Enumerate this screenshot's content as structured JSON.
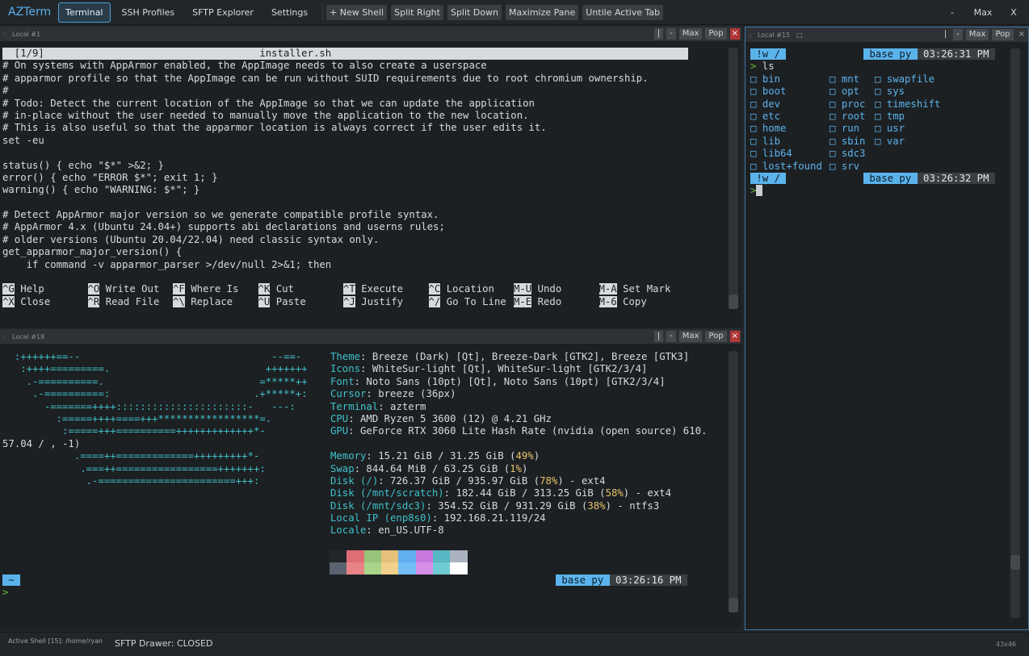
{
  "app": {
    "title": "AZTerm"
  },
  "tabs": [
    "Terminal",
    "SSH Profiles",
    "SFTP Explorer",
    "Settings"
  ],
  "toolbar": {
    "new_shell": "+ New Shell",
    "split_right": "Split Right",
    "split_down": "Split Down",
    "maximize_pane": "Maximize Pane",
    "untile": "Untile Active Tab"
  },
  "window_controls": {
    "minimize": "-",
    "maximize": "Max",
    "close": "X"
  },
  "pane_buttons": {
    "divider": "|",
    "minus": "-",
    "max": "Max",
    "pop": "Pop",
    "close": "×"
  },
  "panes": {
    "top_left": {
      "title": "Local #1",
      "nano": {
        "title_bar": "  [1/9]                                    installer.sh                                    ",
        "lines": [
          "# On systems with AppArmor enabled, the AppImage needs to also create a userspace",
          "# apparmor profile so that the AppImage can be run without SUID requirements due to root chromium ownership.",
          "#",
          "# Todo: Detect the current location of the AppImage so that we can update the application",
          "# in-place without the user needed to manually move the application to the new location.",
          "# This is also useful so that the apparmor location is always correct if the user edits it.",
          "set -eu",
          "",
          "status() { echo \"$*\" >&2; }",
          "error() { echo \"ERROR $*\"; exit 1; }",
          "warning() { echo \"WARNING: $*\"; }",
          "",
          "# Detect AppArmor major version so we generate compatible profile syntax.",
          "# AppArmor 4.x (Ubuntu 24.04+) supports abi declarations and userns rules;",
          "# older versions (Ubuntu 20.04/22.04) need classic syntax only.",
          "get_apparmor_major_version() {",
          "    if command -v apparmor_parser >/dev/null 2>&1; then"
        ],
        "shortcuts_row1": [
          {
            "key": "^G",
            "label": "Help"
          },
          {
            "key": "^O",
            "label": "Write Out"
          },
          {
            "key": "^F",
            "label": "Where Is"
          },
          {
            "key": "^K",
            "label": "Cut"
          },
          {
            "key": "^T",
            "label": "Execute"
          },
          {
            "key": "^C",
            "label": "Location"
          },
          {
            "key": "M-U",
            "label": "Undo"
          },
          {
            "key": "M-A",
            "label": "Set Mark"
          }
        ],
        "shortcuts_row2": [
          {
            "key": "^X",
            "label": "Close"
          },
          {
            "key": "^R",
            "label": "Read File"
          },
          {
            "key": "^\\",
            "label": "Replace"
          },
          {
            "key": "^U",
            "label": "Paste"
          },
          {
            "key": "^J",
            "label": "Justify"
          },
          {
            "key": "^/",
            "label": "Go To Line"
          },
          {
            "key": "M-E",
            "label": "Redo"
          },
          {
            "key": "M-6",
            "label": "Copy"
          }
        ]
      }
    },
    "bottom_left": {
      "title": "Local #18",
      "logo_lines": [
        "  :++++++==--                                --==-",
        "   :++++=========.                          +++++++",
        "    .-==========.                          =*****++",
        "     .-==========:                        .+*****+:",
        "       -=======++++::::::::::::::::::::::-   ---:",
        "         :=====++++====+++*****************=.",
        "          :=====+++==========+++++++++++++*-",
        "57.04 / , -1)",
        "            .====++=============+++++++++*-",
        "             .===++=================+++++++:",
        "              .-=======================+++:"
      ],
      "info": [
        {
          "k": "Theme",
          "v": " Breeze (Dark) [Qt], Breeze-Dark [GTK2], Breeze [GTK3]"
        },
        {
          "k": "Icons",
          "v": " WhiteSur-light [Qt], WhiteSur-light [GTK2/3/4]"
        },
        {
          "k": "Font",
          "v": " Noto Sans (10pt) [Qt], Noto Sans (10pt) [GTK2/3/4]"
        },
        {
          "k": "Cursor",
          "v": " breeze (36px)"
        },
        {
          "k": "Terminal",
          "v": " azterm"
        },
        {
          "k": "CPU",
          "v": " AMD Ryzen 5 3600 (12) @ 4.21 GHz"
        },
        {
          "k": "GPU",
          "v": " GeForce RTX 3060 Lite Hash Rate (nvidia (open source) 610."
        },
        {
          "k": "",
          "v": ""
        },
        {
          "k": "Memory",
          "v": " 15.21 GiB / 31.25 GiB (",
          "pct": "49%",
          "end": ")"
        },
        {
          "k": "Swap",
          "v": " 844.64 MiB / 63.25 GiB (",
          "pct": "1%",
          "end": ")"
        },
        {
          "k": "Disk (/)",
          "v": " 726.37 GiB / 935.97 GiB (",
          "pct": "78%",
          "end": ") - ext4"
        },
        {
          "k": "Disk (/mnt/scratch)",
          "v": " 182.44 GiB / 313.25 GiB (",
          "pct": "58%",
          "end": ") - ext4"
        },
        {
          "k": "Disk (/mnt/sdc3)",
          "v": " 354.52 GiB / 931.29 GiB (",
          "pct": "38%",
          "end": ") - ntfs3"
        },
        {
          "k": "Local IP (enp8s0)",
          "v": " 192.168.21.119/24"
        },
        {
          "k": "Locale",
          "v": " en_US.UTF-8"
        }
      ],
      "palette_top": [
        "#232629",
        "#e06c75",
        "#98c379",
        "#e5c07b",
        "#61afef",
        "#c678dd",
        "#56b6c2",
        "#abb2bf"
      ],
      "palette_bottom": [
        "#5c6370",
        "#e88388",
        "#a9d48a",
        "#f0d18b",
        "#74bdf5",
        "#d58fe8",
        "#6fcad4",
        "#ffffff"
      ],
      "prompt": {
        "dir": " ~ ",
        "env": " base py ",
        "time": " 03:26:16 PM ",
        "symbol": ">"
      }
    },
    "right": {
      "title": "Local #15",
      "prompt1": {
        "dir": " !w / ",
        "env": " base py ",
        "time": " 03:26:31 PM ",
        "symbol": ">",
        "cmd": " ls"
      },
      "ls_cols": [
        [
          "bin",
          "boot",
          "dev",
          "etc",
          "home",
          "lib",
          "lib64",
          "lost+found"
        ],
        [
          "mnt",
          "opt",
          "proc",
          "root",
          "run",
          "sbin",
          "sdc3",
          "srv"
        ],
        [
          "swapfile",
          "sys",
          "timeshift",
          "tmp",
          "usr",
          "var"
        ]
      ],
      "ls_icon": "□",
      "prompt2": {
        "dir": " !w / ",
        "env": " base py ",
        "time": " 03:26:32 PM ",
        "symbol": ">"
      }
    }
  },
  "status": {
    "active_shell": "Active Shell [15]: /home/ryan",
    "sftp": "SFTP Drawer: CLOSED",
    "size": "43x46"
  }
}
